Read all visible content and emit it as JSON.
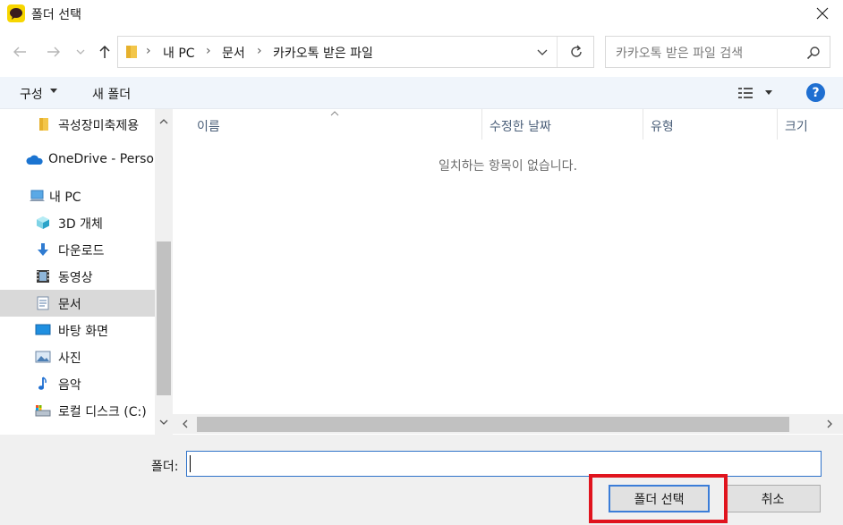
{
  "window": {
    "title": "폴더 선택",
    "app_icon": "kakaotalk-icon",
    "close_icon": "close-icon"
  },
  "navigation": {
    "back_icon": "arrow-left-icon",
    "forward_icon": "arrow-right-icon",
    "recent_icon": "chevron-down-icon",
    "up_icon": "arrow-up-icon"
  },
  "address": {
    "breadcrumbs": [
      "내 PC",
      "문서",
      "카카오톡 받은 파일"
    ],
    "separator": "›",
    "dropdown_icon": "chevron-down-icon",
    "refresh_icon": "refresh-icon"
  },
  "search": {
    "placeholder": "카카오톡 받은 파일 검색",
    "icon": "search-icon"
  },
  "toolbar": {
    "organize_label": "구성",
    "new_folder_label": "새 폴더",
    "view_icon": "details-view-icon",
    "help_label": "?"
  },
  "sidebar": {
    "items": [
      {
        "label": "곡성장미축제용",
        "icon": "folder-icon",
        "selected": false
      },
      {
        "label": "OneDrive - Perso",
        "icon": "onedrive-icon",
        "selected": false
      },
      {
        "label": "내 PC",
        "icon": "this-pc-icon",
        "selected": false
      },
      {
        "label": "3D 개체",
        "icon": "3d-objects-icon",
        "selected": false
      },
      {
        "label": "다운로드",
        "icon": "downloads-icon",
        "selected": false
      },
      {
        "label": "동영상",
        "icon": "videos-icon",
        "selected": false
      },
      {
        "label": "문서",
        "icon": "documents-icon",
        "selected": true
      },
      {
        "label": "바탕 화면",
        "icon": "desktop-icon",
        "selected": false
      },
      {
        "label": "사진",
        "icon": "pictures-icon",
        "selected": false
      },
      {
        "label": "음악",
        "icon": "music-icon",
        "selected": false
      },
      {
        "label": "로컬 디스크 (C:)",
        "icon": "local-disk-icon",
        "selected": false
      }
    ]
  },
  "filelist": {
    "columns": [
      "이름",
      "수정한 날짜",
      "유형",
      "크기"
    ],
    "empty_message": "일치하는 항목이 없습니다."
  },
  "footer": {
    "folder_label": "폴더:",
    "folder_value": "",
    "select_button": "폴더 선택",
    "cancel_button": "취소"
  },
  "colors": {
    "accent": "#1f6fd1",
    "highlight": "#e0141e",
    "selected_bg": "#d9d9d9"
  }
}
